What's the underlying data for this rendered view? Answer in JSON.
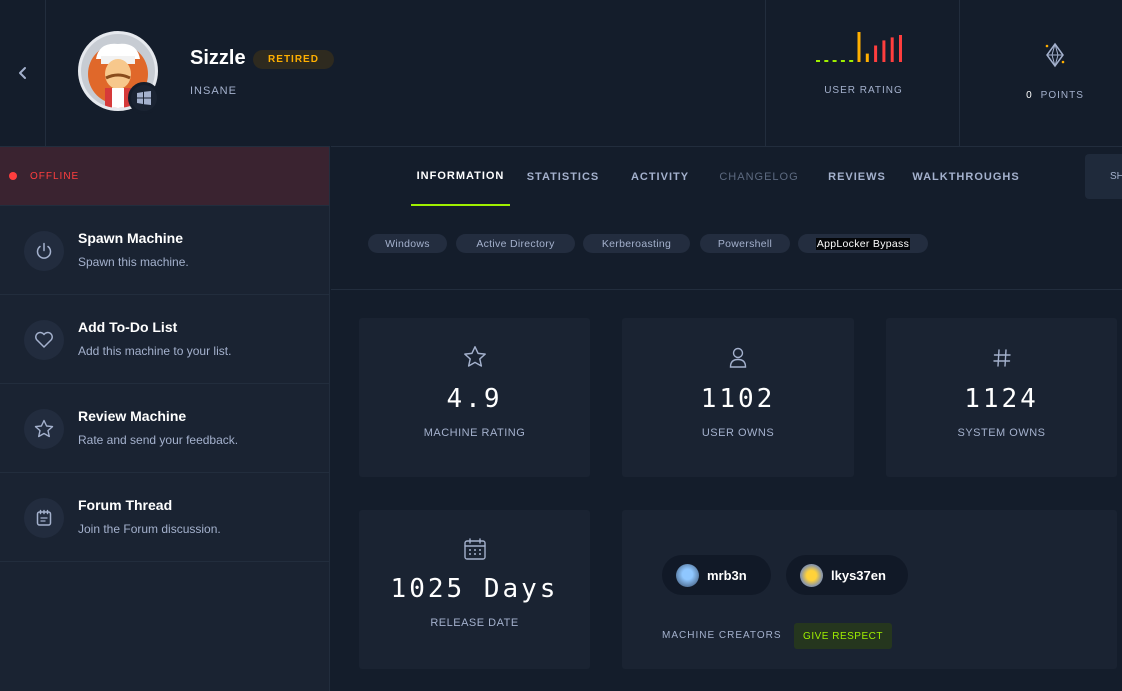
{
  "machine": {
    "name": "Sizzle",
    "status_badge": "RETIRED",
    "difficulty": "INSANE",
    "os_icon": "windows-icon"
  },
  "header": {
    "rating_label": "USER RATING",
    "rating_bars": [
      0,
      0,
      0,
      0,
      0,
      1.0,
      0.28,
      0.55,
      0.72,
      0.82,
      0.9
    ],
    "points_value": "0",
    "points_label": "POINTS",
    "colors": {
      "bar_low": "#9fef00",
      "bar_mid": "#ffaf00",
      "bar_high": "#ff3e3e"
    }
  },
  "sidebar": {
    "status": "OFFLINE",
    "actions": [
      {
        "title": "Spawn Machine",
        "subtitle": "Spawn this machine.",
        "icon": "power-icon"
      },
      {
        "title": "Add To-Do List",
        "subtitle": "Add this machine to your list.",
        "icon": "heart-icon"
      },
      {
        "title": "Review Machine",
        "subtitle": "Rate and send your feedback.",
        "icon": "star-icon"
      },
      {
        "title": "Forum Thread",
        "subtitle": "Join the Forum discussion.",
        "icon": "forum-icon"
      }
    ]
  },
  "tabs": [
    "INFORMATION",
    "STATISTICS",
    "ACTIVITY",
    "CHANGELOG",
    "REVIEWS",
    "WALKTHROUGHS"
  ],
  "active_tab": "INFORMATION",
  "share_label": "SH",
  "tags": [
    "Windows",
    "Active Directory",
    "Kerberoasting",
    "Powershell",
    "AppLocker Bypass"
  ],
  "stats": {
    "rating": {
      "value": "4.9",
      "label": "MACHINE RATING"
    },
    "user_owns": {
      "value": "1102",
      "label": "USER OWNS"
    },
    "system_owns": {
      "value": "1124",
      "label": "SYSTEM OWNS"
    },
    "release": {
      "value": "1025 Days",
      "label": "RELEASE DATE"
    }
  },
  "creators": {
    "list": [
      "mrb3n",
      "lkys37en"
    ],
    "label": "MACHINE CREATORS",
    "respect_label": "GIVE RESPECT"
  },
  "colors": {
    "accent": "#9fef00",
    "offline": "#ff3e3e",
    "retired": "#ffaf00"
  }
}
